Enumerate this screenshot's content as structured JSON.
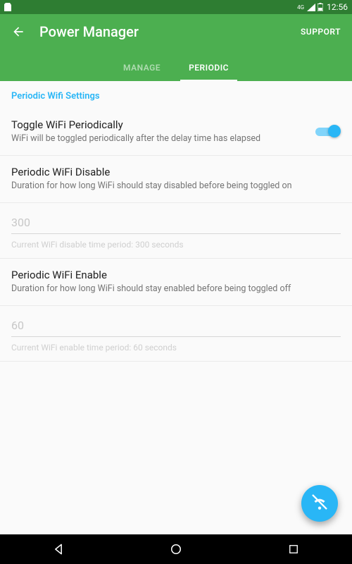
{
  "statusbar": {
    "signal": "4G",
    "time": "12:56"
  },
  "appbar": {
    "title": "Power Manager",
    "support": "SUPPORT",
    "tabs": [
      {
        "label": "MANAGE",
        "active": false
      },
      {
        "label": "PERIODIC",
        "active": true
      }
    ]
  },
  "section_header": "Periodic Wifi Settings",
  "items": {
    "toggle": {
      "title": "Toggle WiFi Periodically",
      "desc": "WiFi will be toggled periodically after the delay time has elapsed",
      "on": true
    },
    "disable": {
      "title": "Periodic WiFi Disable",
      "desc": "Duration for how long WiFi should stay disabled before being toggled on",
      "value": "300",
      "hint": "Current WiFi disable time period: 300 seconds"
    },
    "enable": {
      "title": "Periodic WiFi Enable",
      "desc": "Duration for how long WiFi should stay enabled before being toggled off",
      "value": "60",
      "hint": "Current WiFi enable time period: 60 seconds"
    }
  }
}
